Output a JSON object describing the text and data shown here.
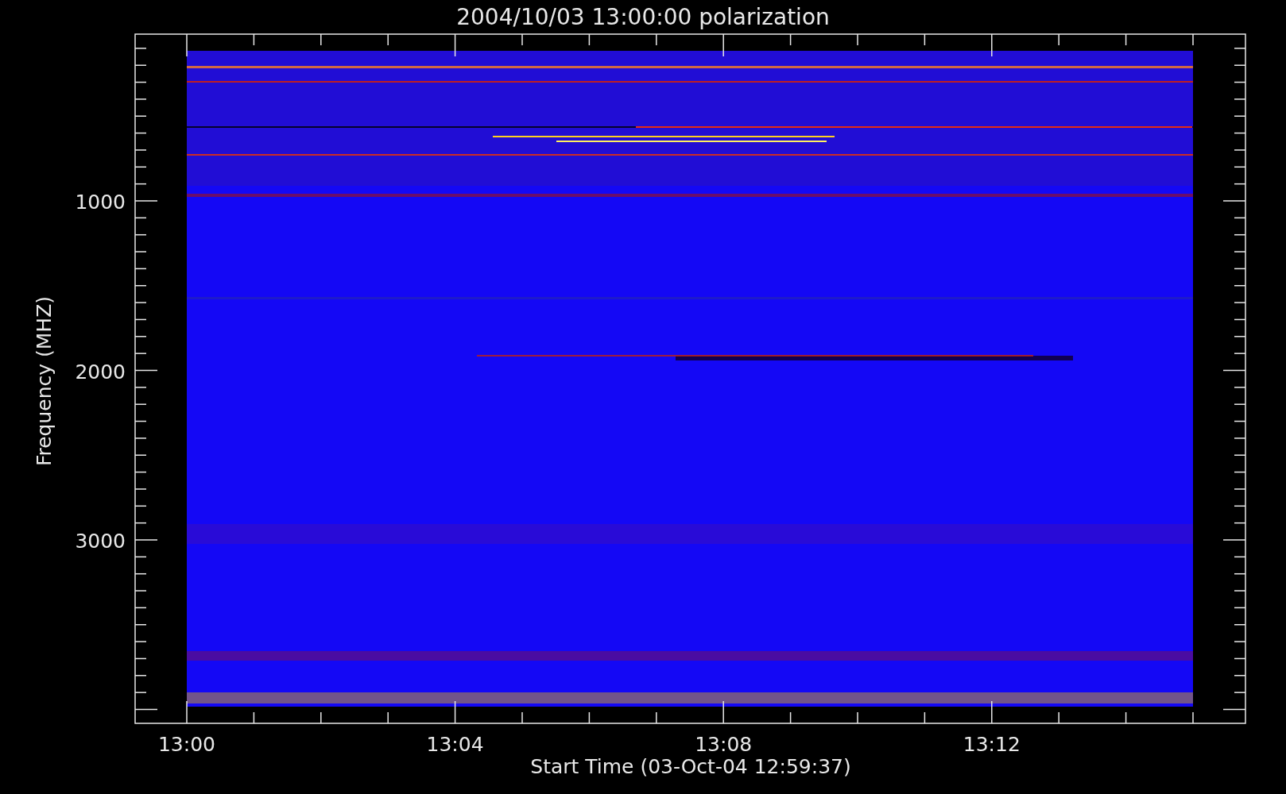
{
  "title": "2004/10/03 13:00:00 polarization",
  "x_axis": {
    "title": "Start Time (03-Oct-04 12:59:37)",
    "ticks": [
      "13:00",
      "13:04",
      "13:08",
      "13:12"
    ]
  },
  "y_axis": {
    "title": "Frequency (MHZ)",
    "ticks": [
      "1000",
      "2000",
      "3000"
    ]
  }
}
